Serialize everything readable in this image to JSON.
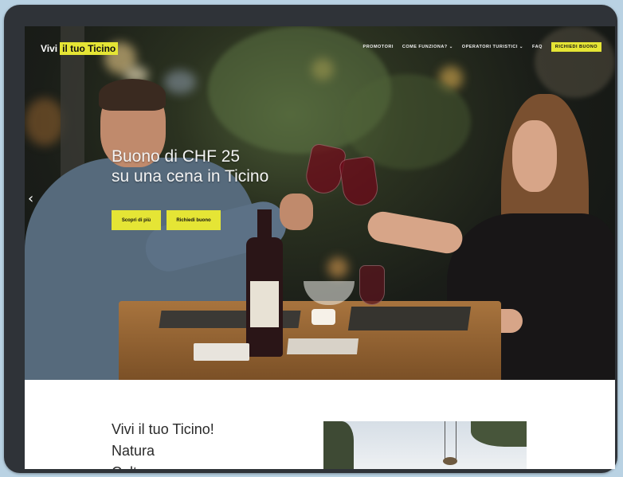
{
  "site": {
    "logo_prefix": "Vivi",
    "logo_highlight": "il tuo Ticino"
  },
  "nav": {
    "items": [
      "PROMOTORI",
      "COME FUNZIONA? ⌄",
      "OPERATORI TURISTICI ⌄",
      "FAQ"
    ],
    "cta": "RICHIEDI BUONO"
  },
  "hero": {
    "headline_line1": "Buono di CHF 25",
    "headline_line2": "su una cena in Ticino",
    "button_primary": "Scopri di più",
    "button_secondary": "Richiedi buono",
    "prev_arrow": "‹"
  },
  "intro": {
    "line1": "Vivi il tuo Ticino!",
    "line2": "Natura",
    "line3": "Cultura"
  },
  "colors": {
    "accent": "#e5e535",
    "frame": "#2f3338",
    "background": "#b9d2e3"
  }
}
